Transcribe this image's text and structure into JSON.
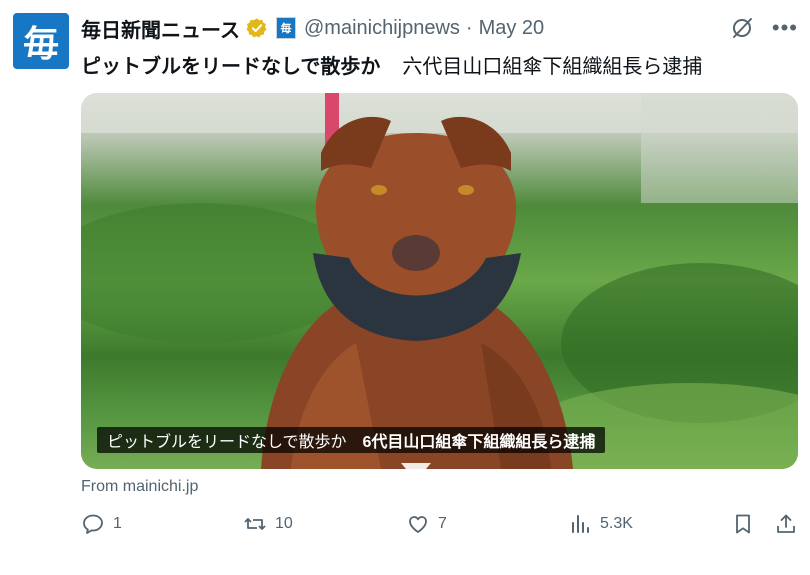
{
  "account": {
    "avatar_glyph": "毎",
    "display_name": "毎日新聞ニュース",
    "handle": "@mainichijpnews",
    "separator": "·",
    "date": "May 20",
    "affiliation_glyph": "毎"
  },
  "tweet": {
    "text_bold": "ピットブルをリードなしで散歩か",
    "text_rest": "六代目山口組傘下組織組長ら逮捕"
  },
  "media": {
    "caption_a": "ピットブルをリードなしで散歩か",
    "caption_b": "6代目山口組傘下組織組長ら逮捕"
  },
  "card": {
    "source": "From mainichi.jp"
  },
  "actions": {
    "reply_count": "1",
    "repost_count": "10",
    "like_count": "7",
    "view_count": "5.3K"
  },
  "icons": [
    "verified-badge-icon",
    "grok-icon",
    "more-icon",
    "reply-icon",
    "repost-icon",
    "like-icon",
    "views-icon",
    "bookmark-icon",
    "share-icon"
  ],
  "colors": {
    "brand": "#1877c4",
    "verified": "#e2b719",
    "muted": "#536471"
  }
}
